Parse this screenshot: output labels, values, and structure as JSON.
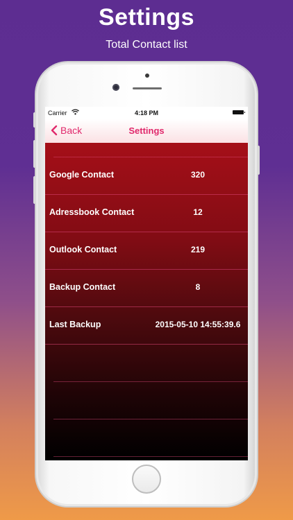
{
  "promo": {
    "title": "Settings",
    "subtitle": "Total Contact list"
  },
  "statusbar": {
    "carrier": "Carrier",
    "time": "4:18 PM"
  },
  "navbar": {
    "back_label": "Back",
    "title": "Settings"
  },
  "rows": [
    {
      "label": "Google Contact",
      "value": "320"
    },
    {
      "label": "Adressbook Contact",
      "value": "12"
    },
    {
      "label": "Outlook Contact",
      "value": "219"
    },
    {
      "label": "Backup Contact",
      "value": "8"
    },
    {
      "label": "Last Backup",
      "value": "2015-05-10 14:55:39.6"
    }
  ],
  "colors": {
    "accent": "#e0286b",
    "table_top": "#a50f18",
    "background_top": "#5d2d91",
    "background_bottom": "#ef9a48"
  }
}
